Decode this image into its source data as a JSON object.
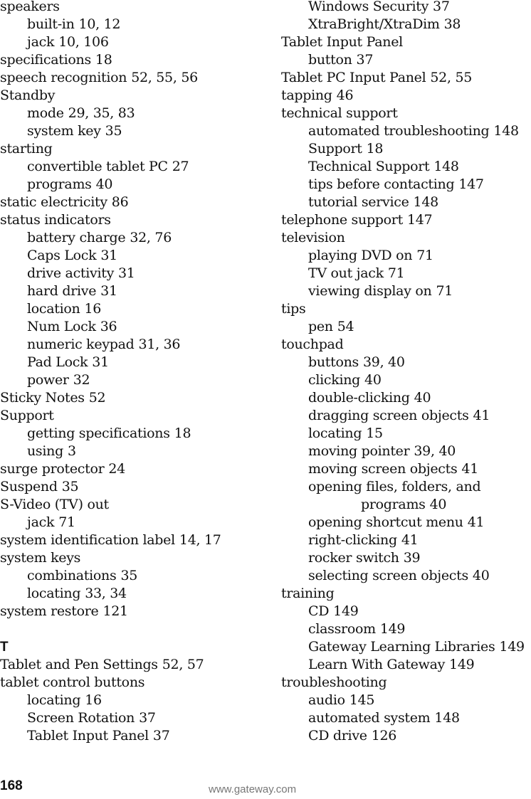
{
  "left_column": [
    {
      "level": "main",
      "term": "speakers",
      "pages": ""
    },
    {
      "level": "sub",
      "term": "built-in",
      "pages": "10, 12"
    },
    {
      "level": "sub",
      "term": "jack",
      "pages": "10, 106"
    },
    {
      "level": "main",
      "term": "specifications",
      "pages": "18"
    },
    {
      "level": "main",
      "term": "speech recognition",
      "pages": "52, 55, 56"
    },
    {
      "level": "main",
      "term": "Standby",
      "pages": ""
    },
    {
      "level": "sub",
      "term": "mode",
      "pages": "29, 35, 83"
    },
    {
      "level": "sub",
      "term": "system key",
      "pages": "35"
    },
    {
      "level": "main",
      "term": "starting",
      "pages": ""
    },
    {
      "level": "sub",
      "term": "convertible tablet PC",
      "pages": "27"
    },
    {
      "level": "sub",
      "term": "programs",
      "pages": "40"
    },
    {
      "level": "main",
      "term": "static electricity",
      "pages": "86"
    },
    {
      "level": "main",
      "term": "status indicators",
      "pages": ""
    },
    {
      "level": "sub",
      "term": "battery charge",
      "pages": "32, 76"
    },
    {
      "level": "sub",
      "term": "Caps Lock",
      "pages": "31"
    },
    {
      "level": "sub",
      "term": "drive activity",
      "pages": "31"
    },
    {
      "level": "sub",
      "term": "hard drive",
      "pages": "31"
    },
    {
      "level": "sub",
      "term": "location",
      "pages": "16"
    },
    {
      "level": "sub",
      "term": "Num Lock",
      "pages": "36"
    },
    {
      "level": "sub",
      "term": "numeric keypad",
      "pages": "31, 36"
    },
    {
      "level": "sub",
      "term": "Pad Lock",
      "pages": "31"
    },
    {
      "level": "sub",
      "term": "power",
      "pages": "32"
    },
    {
      "level": "main",
      "term": "Sticky Notes",
      "pages": "52"
    },
    {
      "level": "main",
      "term": "Support",
      "pages": ""
    },
    {
      "level": "sub",
      "term": "getting specifications",
      "pages": "18"
    },
    {
      "level": "sub",
      "term": "using",
      "pages": "3"
    },
    {
      "level": "main",
      "term": "surge protector",
      "pages": "24"
    },
    {
      "level": "main",
      "term": "Suspend",
      "pages": "35"
    },
    {
      "level": "main",
      "term": "S-Video (TV) out",
      "pages": ""
    },
    {
      "level": "sub",
      "term": "jack",
      "pages": "71"
    },
    {
      "level": "main",
      "term": "system identification label",
      "pages": "14, 17"
    },
    {
      "level": "main",
      "term": "system keys",
      "pages": ""
    },
    {
      "level": "sub",
      "term": "combinations",
      "pages": "35"
    },
    {
      "level": "sub",
      "term": "locating",
      "pages": "33, 34"
    },
    {
      "level": "main",
      "term": "system restore",
      "pages": "121"
    },
    {
      "level": "spacer",
      "term": "",
      "pages": ""
    },
    {
      "level": "heading",
      "term": "T",
      "pages": ""
    },
    {
      "level": "main",
      "term": "Tablet and Pen Settings",
      "pages": "52, 57"
    },
    {
      "level": "main",
      "term": "tablet control buttons",
      "pages": ""
    },
    {
      "level": "sub",
      "term": "locating",
      "pages": "16"
    },
    {
      "level": "sub",
      "term": "Screen Rotation",
      "pages": "37"
    },
    {
      "level": "sub",
      "term": "Tablet Input Panel",
      "pages": "37"
    }
  ],
  "right_column": [
    {
      "level": "sub",
      "term": "Windows Security",
      "pages": "37"
    },
    {
      "level": "sub",
      "term": "XtraBright/XtraDim",
      "pages": "38"
    },
    {
      "level": "main",
      "term": "Tablet Input Panel",
      "pages": ""
    },
    {
      "level": "sub",
      "term": "button",
      "pages": "37"
    },
    {
      "level": "main",
      "term": "Tablet PC Input Panel",
      "pages": "52, 55"
    },
    {
      "level": "main",
      "term": "tapping",
      "pages": "46"
    },
    {
      "level": "main",
      "term": "technical support",
      "pages": ""
    },
    {
      "level": "sub",
      "term": "automated troubleshooting",
      "pages": "148"
    },
    {
      "level": "sub",
      "term": "Support",
      "pages": "18"
    },
    {
      "level": "sub",
      "term": "Technical Support",
      "pages": "148"
    },
    {
      "level": "sub",
      "term": "tips before contacting",
      "pages": "147"
    },
    {
      "level": "sub",
      "term": "tutorial service",
      "pages": "148"
    },
    {
      "level": "main",
      "term": "telephone support",
      "pages": "147"
    },
    {
      "level": "main",
      "term": "television",
      "pages": ""
    },
    {
      "level": "sub",
      "term": "playing DVD on",
      "pages": "71"
    },
    {
      "level": "sub",
      "term": "TV out jack",
      "pages": "71"
    },
    {
      "level": "sub",
      "term": "viewing display on",
      "pages": "71"
    },
    {
      "level": "main",
      "term": "tips",
      "pages": ""
    },
    {
      "level": "sub",
      "term": "pen",
      "pages": "54"
    },
    {
      "level": "main",
      "term": "touchpad",
      "pages": ""
    },
    {
      "level": "sub",
      "term": "buttons",
      "pages": "39, 40"
    },
    {
      "level": "sub",
      "term": "clicking",
      "pages": "40"
    },
    {
      "level": "sub",
      "term": "double-clicking",
      "pages": "40"
    },
    {
      "level": "sub",
      "term": "dragging screen objects",
      "pages": "41"
    },
    {
      "level": "sub",
      "term": "locating",
      "pages": "15"
    },
    {
      "level": "sub",
      "term": "moving pointer",
      "pages": "39, 40"
    },
    {
      "level": "sub",
      "term": "moving screen objects",
      "pages": "41"
    },
    {
      "level": "sub",
      "term": "opening files, folders, and",
      "pages": ""
    },
    {
      "level": "cont",
      "term": "programs",
      "pages": "40"
    },
    {
      "level": "sub",
      "term": "opening shortcut menu",
      "pages": "41"
    },
    {
      "level": "sub",
      "term": "right-clicking",
      "pages": "41"
    },
    {
      "level": "sub",
      "term": "rocker switch",
      "pages": "39"
    },
    {
      "level": "sub",
      "term": "selecting screen objects",
      "pages": "40"
    },
    {
      "level": "main",
      "term": "training",
      "pages": ""
    },
    {
      "level": "sub",
      "term": "CD",
      "pages": "149"
    },
    {
      "level": "sub",
      "term": "classroom",
      "pages": "149"
    },
    {
      "level": "sub",
      "term": "Gateway Learning Libraries",
      "pages": "149"
    },
    {
      "level": "sub",
      "term": "Learn With Gateway",
      "pages": "149"
    },
    {
      "level": "main",
      "term": "troubleshooting",
      "pages": ""
    },
    {
      "level": "sub",
      "term": "audio",
      "pages": "145"
    },
    {
      "level": "sub",
      "term": "automated system",
      "pages": "148"
    },
    {
      "level": "sub",
      "term": "CD drive",
      "pages": "126"
    }
  ],
  "footer": {
    "page_number": "168",
    "url": "www.gateway.com"
  },
  "colors": {
    "text": "#111111",
    "footer_url": "#777777"
  }
}
